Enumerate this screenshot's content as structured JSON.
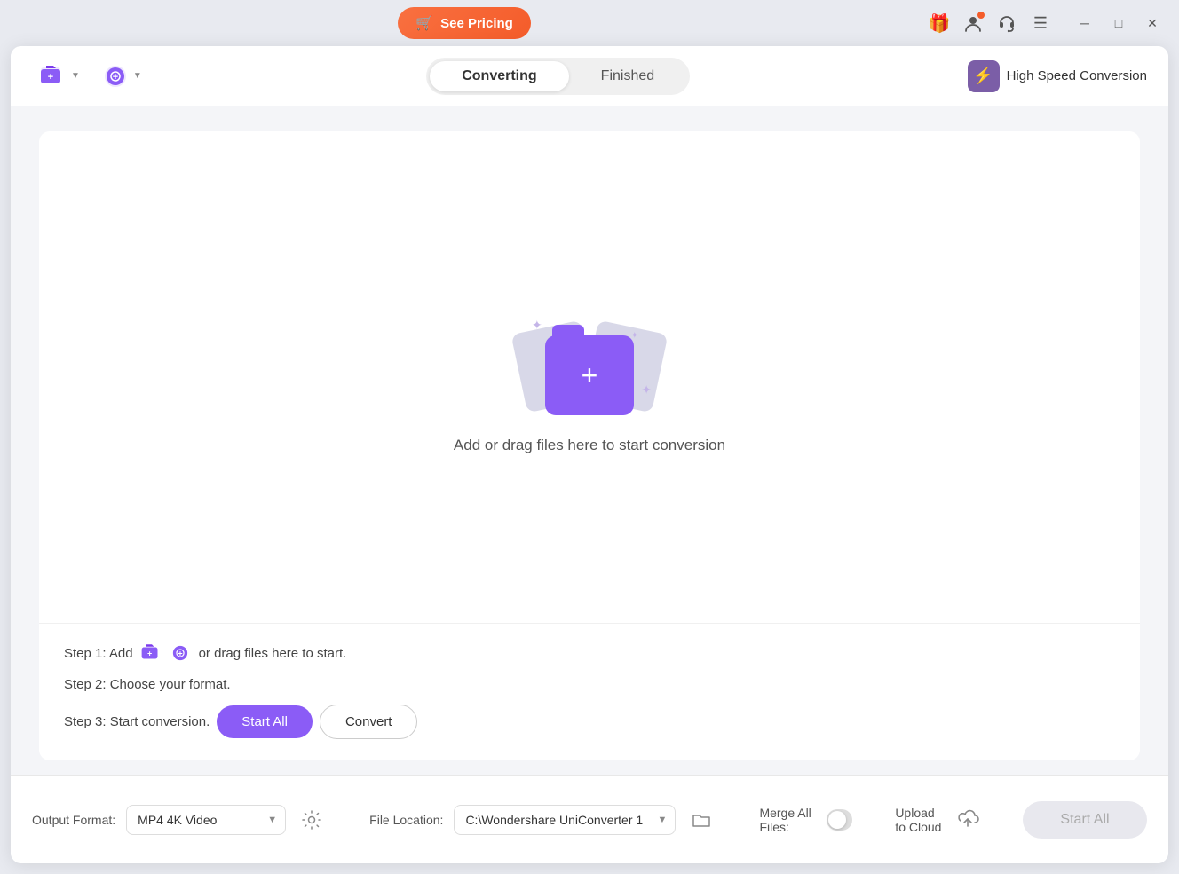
{
  "titlebar": {
    "see_pricing_label": "See Pricing",
    "cart_icon": "🛒",
    "gift_icon": "🎁",
    "menu_icon": "☰",
    "minimize_icon": "─",
    "maximize_icon": "□",
    "close_icon": "✕"
  },
  "header": {
    "tab_converting": "Converting",
    "tab_finished": "Finished",
    "high_speed_label": "High Speed Conversion",
    "bolt_icon": "⚡"
  },
  "drop_zone": {
    "drop_text": "Add or drag files here to start conversion",
    "plus_icon": "+"
  },
  "steps": {
    "step1_prefix": "Step 1: Add",
    "step1_suffix": "or drag files here to start.",
    "step2": "Step 2: Choose your format.",
    "step3_prefix": "Step 3: Start conversion.",
    "start_all_label": "Start All",
    "convert_label": "Convert"
  },
  "bottom": {
    "output_format_label": "Output Format:",
    "output_format_value": "MP4 4K Video",
    "file_location_label": "File Location:",
    "file_location_value": "C:\\Wondershare UniConverter 1",
    "merge_label": "Merge All Files:",
    "upload_label": "Upload to Cloud",
    "start_all_label": "Start All"
  }
}
